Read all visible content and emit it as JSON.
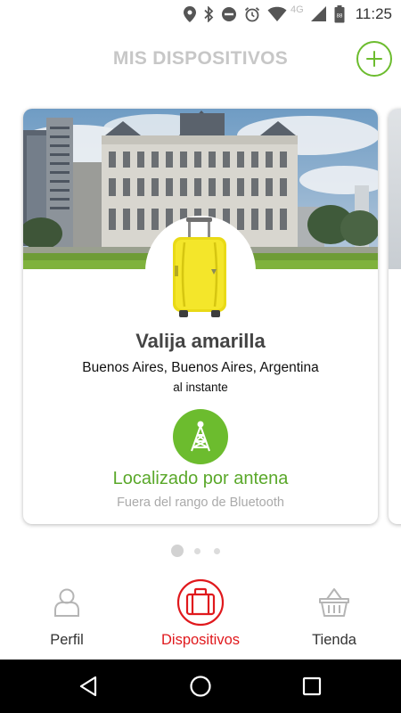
{
  "status_bar": {
    "time": "11:25",
    "network": "4G",
    "icons": [
      "location-icon",
      "bluetooth-icon",
      "do-not-disturb-icon",
      "alarm-icon",
      "wifi-icon",
      "signal-icon",
      "battery-icon"
    ]
  },
  "header": {
    "title": "MIS DISPOSITIVOS",
    "add_icon": "plus-circle-icon"
  },
  "colors": {
    "accent_green": "#6cbc2e",
    "status_green": "#5aa82a",
    "active_red": "#e0191d",
    "title_gray": "#c7c7c7"
  },
  "device_card": {
    "name": "Valija amarilla",
    "location": "Buenos Aires, Buenos Aires, Argentina",
    "last_seen": "al instante",
    "locate_icon": "antenna-icon",
    "locate_status": "Localizado por antena",
    "bluetooth_status": "Fuera del rango de Bluetooth"
  },
  "pager": {
    "total": 3,
    "active": 1
  },
  "tabs": [
    {
      "label": "Perfil",
      "icon": "user-icon",
      "active": false
    },
    {
      "label": "Dispositivos",
      "icon": "suitcase-icon",
      "active": true
    },
    {
      "label": "Tienda",
      "icon": "basket-icon",
      "active": false
    }
  ],
  "nav": [
    "back-icon",
    "home-icon",
    "recents-icon"
  ]
}
